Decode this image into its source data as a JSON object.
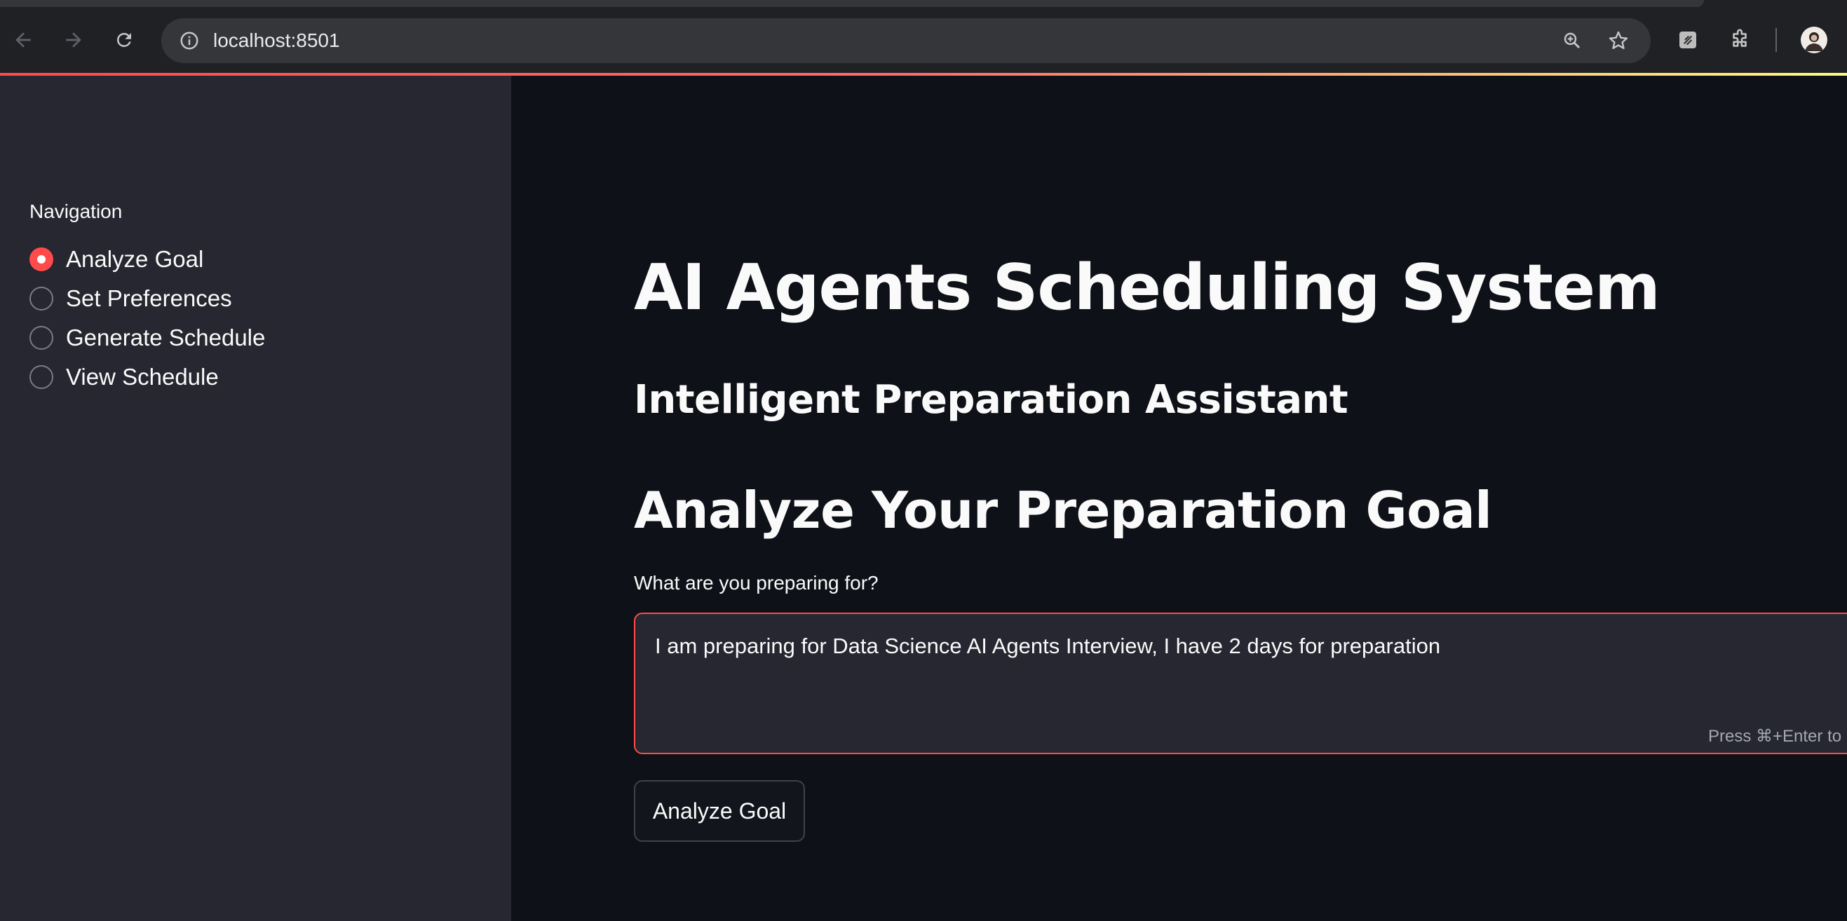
{
  "browser": {
    "url": "localhost:8501",
    "back_icon": "back-arrow-icon",
    "forward_icon": "forward-arrow-icon",
    "reload_icon": "reload-icon",
    "site_info_icon": "info-icon",
    "zoom_icon": "zoom-icon",
    "bookmark_icon": "star-icon",
    "extensions_icon": "puzzle-icon"
  },
  "colors": {
    "accent": "#ff4b4b",
    "sidebar_bg": "#262730",
    "main_bg": "#0e1117",
    "text": "#fafafa"
  },
  "sidebar": {
    "heading": "Navigation",
    "options": [
      {
        "label": "Analyze Goal",
        "selected": true
      },
      {
        "label": "Set Preferences",
        "selected": false
      },
      {
        "label": "Generate Schedule",
        "selected": false
      },
      {
        "label": "View Schedule",
        "selected": false
      }
    ]
  },
  "main": {
    "title": "AI Agents Scheduling System",
    "subtitle": "Intelligent Preparation Assistant",
    "section_title": "Analyze Your Preparation Goal",
    "goal_input": {
      "label": "What are you preparing for?",
      "value": "I am preparing for Data Science AI Agents Interview, I have 2 days for preparation",
      "hint": "Press ⌘+Enter to"
    },
    "analyze_button": "Analyze Goal"
  }
}
